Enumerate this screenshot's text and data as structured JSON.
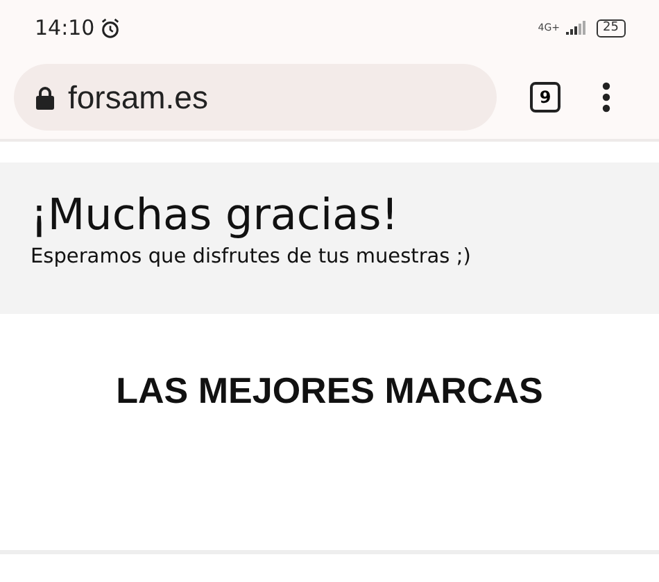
{
  "status_bar": {
    "time": "14:10",
    "network": "4G+",
    "battery": "25"
  },
  "browser": {
    "url": "forsam.es",
    "tab_count": "9"
  },
  "banner": {
    "title": "¡Muchas gracias!",
    "subtitle": "Esperamos que disfrutes de tus muestras ;)"
  },
  "brands": {
    "heading": "LAS MEJORES MARCAS"
  }
}
